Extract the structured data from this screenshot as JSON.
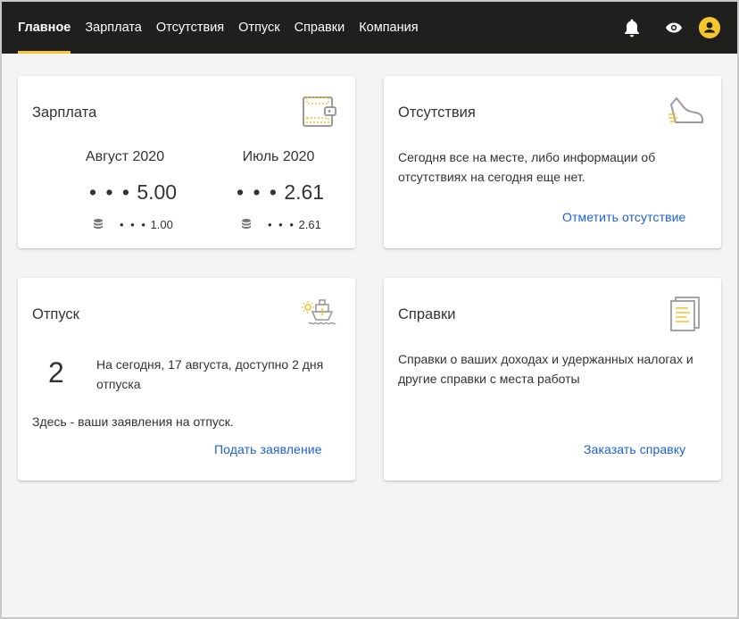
{
  "nav": {
    "items": [
      {
        "label": "Главное",
        "active": true
      },
      {
        "label": "Зарплата",
        "active": false
      },
      {
        "label": "Отсутствия",
        "active": false
      },
      {
        "label": "Отпуск",
        "active": false
      },
      {
        "label": "Справки",
        "active": false
      },
      {
        "label": "Компания",
        "active": false
      }
    ],
    "icons": [
      "bell-icon",
      "eye-icon",
      "user-avatar-icon"
    ]
  },
  "colors": {
    "topbar": "#1f1f1d",
    "accent": "#f7c72a",
    "link": "#1d5fd6",
    "background": "#f4f4f4"
  },
  "salary_card": {
    "title": "Зарплата",
    "icon": "wallet-icon",
    "columns": [
      {
        "month": "Август 2020",
        "dots": "• • •",
        "amount": "5.00",
        "small_dots": "• • •",
        "small_amount": "1.00",
        "small_icon": "coins-icon"
      },
      {
        "month": "Июль 2020",
        "dots": "• • •",
        "amount": "2.61",
        "small_dots": "• • •",
        "small_amount": "2.61",
        "small_icon": "coins-icon"
      }
    ]
  },
  "absence_card": {
    "title": "Отсутствия",
    "icon": "sneaker-icon",
    "text": "Сегодня все на месте, либо информации об отсутствиях на сегодня еще нет.",
    "link": "Отметить отсутствие"
  },
  "vacation_card": {
    "title": "Отпуск",
    "icon": "ship-sun-icon",
    "days": "2",
    "days_text": "На сегодня, 17 августа, доступно 2 дня отпуска",
    "applications_text": "Здесь - ваши заявления на отпуск.",
    "link": "Подать заявление"
  },
  "certificates_card": {
    "title": "Справки",
    "icon": "document-icon",
    "text": "Справки о ваших доходах и удержанных налогах и другие справки с места работы",
    "link": "Заказать справку"
  }
}
